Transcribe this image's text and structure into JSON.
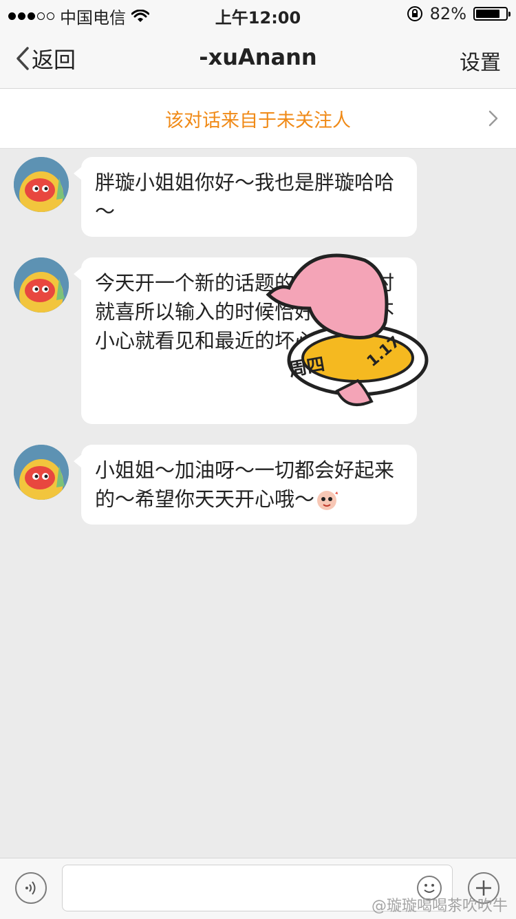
{
  "status_bar": {
    "carrier": "中国电信",
    "time": "上午12:00",
    "battery_percent_label": "82%",
    "battery_level": 0.82
  },
  "nav": {
    "back_label": "返回",
    "title": "-xuAnann",
    "settings_label": "设置"
  },
  "notice": {
    "text": "该对话来自于未关注人"
  },
  "messages": [
    {
      "text": "胖璇小姐姐你好～我也是胖璇哈哈～"
    },
    {
      "text": "今天开一个新的话题的，因为平时就喜所以输入的时候恰好话题，不小心就看见和最近的坏心情～"
    },
    {
      "text": "小姐姐～加油呀～一切都会好起来的～希望你天天开心哦～"
    }
  ],
  "sticker": {
    "text_day": "周四",
    "text_date": "1.17"
  },
  "input_bar": {
    "placeholder": ""
  },
  "watermark": "@璇璇喝喝茶吹吹牛",
  "colors": {
    "accent_orange": "#f08a17",
    "background": "#ebebeb",
    "bubble": "#ffffff"
  }
}
